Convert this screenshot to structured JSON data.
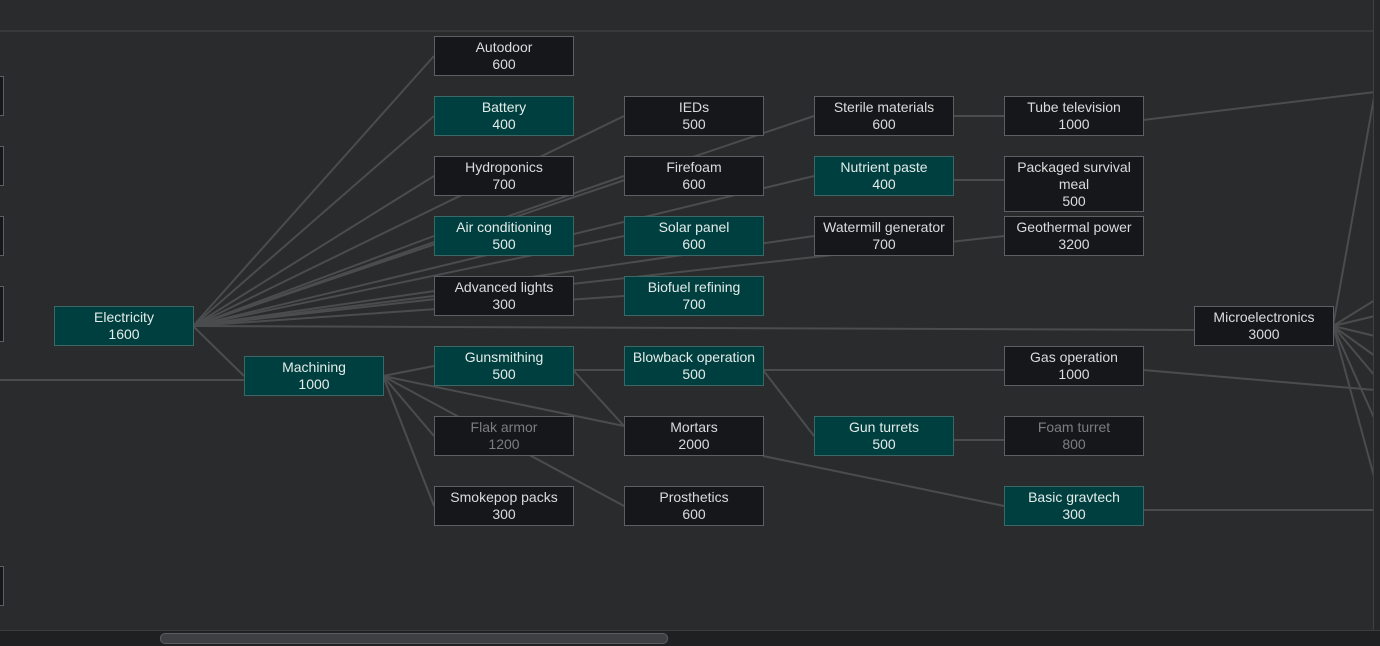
{
  "research_tree": {
    "nodes": [
      {
        "id": "autodoor",
        "name": "Autodoor",
        "cost": "600",
        "state": "available"
      },
      {
        "id": "battery",
        "name": "Battery",
        "cost": "400",
        "state": "done"
      },
      {
        "id": "hydroponics",
        "name": "Hydroponics",
        "cost": "700",
        "state": "available"
      },
      {
        "id": "air-conditioning",
        "name": "Air conditioning",
        "cost": "500",
        "state": "done"
      },
      {
        "id": "advanced-lights",
        "name": "Advanced lights",
        "cost": "300",
        "state": "available"
      },
      {
        "id": "electricity",
        "name": "Electricity",
        "cost": "1600",
        "state": "done"
      },
      {
        "id": "machining",
        "name": "Machining",
        "cost": "1000",
        "state": "done"
      },
      {
        "id": "gunsmithing",
        "name": "Gunsmithing",
        "cost": "500",
        "state": "done"
      },
      {
        "id": "flak-armor",
        "name": "Flak armor",
        "cost": "1200",
        "state": "locked"
      },
      {
        "id": "smokepop-packs",
        "name": "Smokepop packs",
        "cost": "300",
        "state": "available"
      },
      {
        "id": "ieds",
        "name": "IEDs",
        "cost": "500",
        "state": "available"
      },
      {
        "id": "firefoam",
        "name": "Firefoam",
        "cost": "600",
        "state": "available"
      },
      {
        "id": "solar-panel",
        "name": "Solar panel",
        "cost": "600",
        "state": "done"
      },
      {
        "id": "biofuel-refining",
        "name": "Biofuel refining",
        "cost": "700",
        "state": "done"
      },
      {
        "id": "blowback-operation",
        "name": "Blowback operation",
        "cost": "500",
        "state": "done"
      },
      {
        "id": "mortars",
        "name": "Mortars",
        "cost": "2000",
        "state": "available"
      },
      {
        "id": "prosthetics",
        "name": "Prosthetics",
        "cost": "600",
        "state": "available"
      },
      {
        "id": "sterile-materials",
        "name": "Sterile materials",
        "cost": "600",
        "state": "available"
      },
      {
        "id": "nutrient-paste",
        "name": "Nutrient paste",
        "cost": "400",
        "state": "done"
      },
      {
        "id": "watermill-generator",
        "name": "Watermill generator",
        "cost": "700",
        "state": "available"
      },
      {
        "id": "gun-turrets",
        "name": "Gun turrets",
        "cost": "500",
        "state": "done"
      },
      {
        "id": "tube-television",
        "name": "Tube television",
        "cost": "1000",
        "state": "available"
      },
      {
        "id": "packaged-survival-meal",
        "name": "Packaged survival meal",
        "cost": "500",
        "state": "available"
      },
      {
        "id": "geothermal-power",
        "name": "Geothermal power",
        "cost": "3200",
        "state": "available"
      },
      {
        "id": "gas-operation",
        "name": "Gas operation",
        "cost": "1000",
        "state": "available"
      },
      {
        "id": "foam-turret",
        "name": "Foam turret",
        "cost": "800",
        "state": "locked"
      },
      {
        "id": "basic-gravtech",
        "name": "Basic gravtech",
        "cost": "300",
        "state": "done"
      },
      {
        "id": "microelectronics",
        "name": "Microelectronics",
        "cost": "3000",
        "state": "available"
      }
    ]
  },
  "colors": {
    "background": "#2a2b2d",
    "node_done": "#003f3f",
    "node_available": "#16171a",
    "link": "#4a4c4e"
  }
}
